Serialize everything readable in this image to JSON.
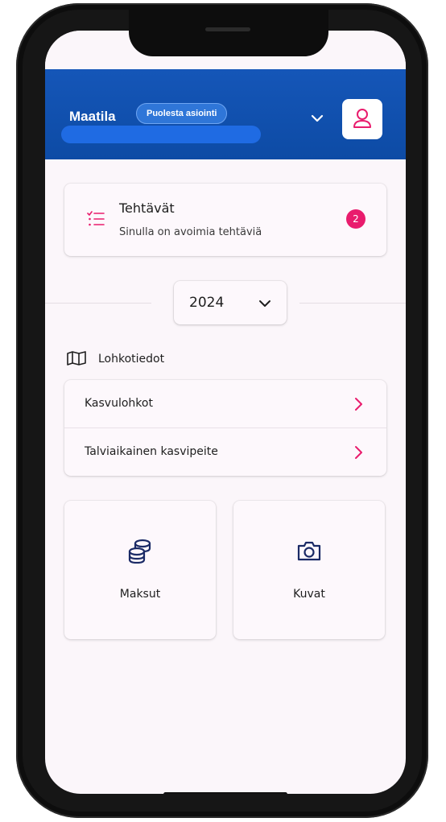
{
  "header": {
    "brand": "Maatila",
    "role_badge": "Puolesta asiointi"
  },
  "tasks": {
    "title": "Tehtävät",
    "subtitle": "Sinulla on avoimia tehtäviä",
    "count": "2"
  },
  "year_selector": {
    "value": "2024"
  },
  "section": {
    "title": "Lohkotiedot"
  },
  "list": [
    {
      "label": "Kasvulohkot"
    },
    {
      "label": "Talviaikainen kasvipeite"
    }
  ],
  "tiles": [
    {
      "label": "Maksut",
      "icon": "coins-icon"
    },
    {
      "label": "Kuvat",
      "icon": "camera-icon"
    }
  ],
  "colors": {
    "header_blue": "#1556b8",
    "accent_pink": "#e91c6d",
    "icon_navy": "#1a2a66"
  }
}
